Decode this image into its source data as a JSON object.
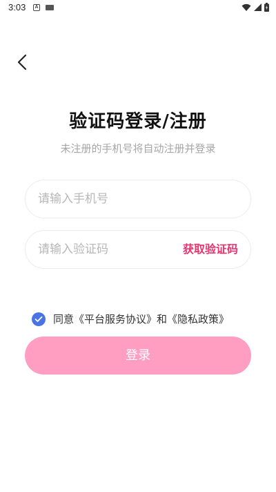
{
  "status_bar": {
    "time": "3:03",
    "notif_letter": "A"
  },
  "title": "验证码登录/注册",
  "subtitle": "未注册的手机号将自动注册并登录",
  "phone_input": {
    "placeholder": "请输入手机号",
    "value": ""
  },
  "code_input": {
    "placeholder": "请输入验证码",
    "value": ""
  },
  "get_code_label": "获取验证码",
  "agreement": {
    "checked": true,
    "prefix": "同意",
    "terms_link": "《平台服务协议》",
    "conjunction": "和",
    "privacy_link": "《隐私政策》"
  },
  "login_label": "登录",
  "colors": {
    "accent": "#e8336e",
    "button_bg": "#ff9ec0",
    "checkbox": "#4a74e6",
    "placeholder": "#b7b7b7"
  },
  "icons": [
    "back-arrow-icon",
    "wifi-icon",
    "signal-icon",
    "battery-icon",
    "check-icon"
  ]
}
